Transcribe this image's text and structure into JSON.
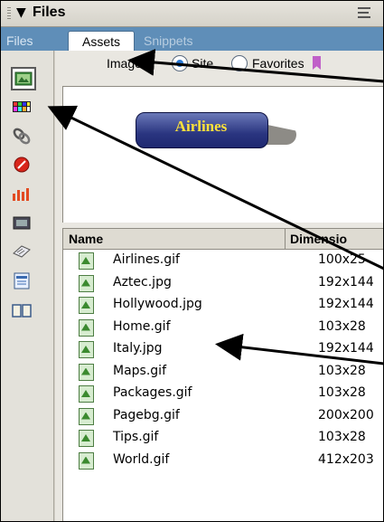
{
  "panel": {
    "title": "Files"
  },
  "tabs": [
    {
      "label": "Files"
    },
    {
      "label": "Assets"
    },
    {
      "label": "Snippets"
    }
  ],
  "filter": {
    "label": "Images:",
    "options": [
      "Site",
      "Favorites"
    ],
    "selected": "Site"
  },
  "preview": {
    "button_text": "Airlines"
  },
  "columns": {
    "name": "Name",
    "dimensions": "Dimensio"
  },
  "files": [
    {
      "name": "Airlines.gif",
      "dimensions": "100x25"
    },
    {
      "name": "Aztec.jpg",
      "dimensions": "192x144"
    },
    {
      "name": "Hollywood.jpg",
      "dimensions": "192x144"
    },
    {
      "name": "Home.gif",
      "dimensions": "103x28"
    },
    {
      "name": "Italy.jpg",
      "dimensions": "192x144"
    },
    {
      "name": "Maps.gif",
      "dimensions": "103x28"
    },
    {
      "name": "Packages.gif",
      "dimensions": "103x28"
    },
    {
      "name": "Pagebg.gif",
      "dimensions": "200x200"
    },
    {
      "name": "Tips.gif",
      "dimensions": "103x28"
    },
    {
      "name": "World.gif",
      "dimensions": "412x203"
    }
  ],
  "asset_categories": [
    "images-icon",
    "colors-icon",
    "urls-icon",
    "flash-icon",
    "shockwave-icon",
    "movies-icon",
    "scripts-icon",
    "templates-icon",
    "library-icon"
  ],
  "colors": {
    "tab_bar": "#5f8eb8",
    "button_fill": "#2a3580",
    "button_text": "#ffe23a"
  }
}
